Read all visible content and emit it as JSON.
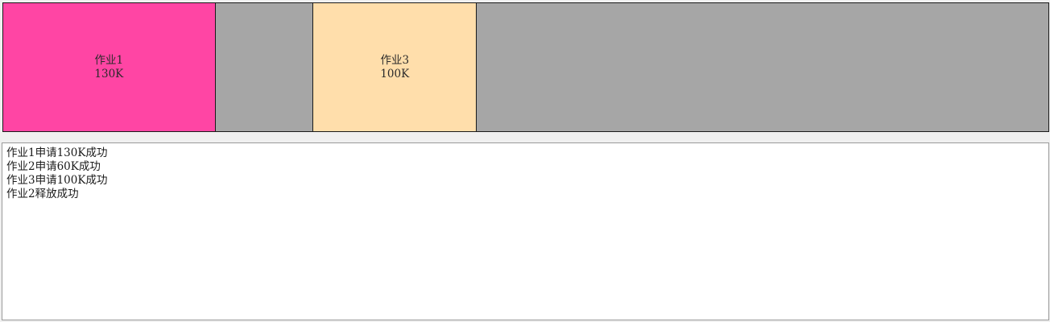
{
  "memory": {
    "blocks": [
      {
        "name": "作业1",
        "size": "130K",
        "color": "#ff45a4",
        "size_kb": 130
      },
      {
        "name": "",
        "size": "",
        "color": "#a6a6a6",
        "size_kb": 60
      },
      {
        "name": "作业3",
        "size": "100K",
        "color": "#ffdeab",
        "size_kb": 100
      },
      {
        "name": "",
        "size": "",
        "color": "#a6a6a6",
        "size_kb": 350
      }
    ]
  },
  "log": {
    "lines": [
      "作业1申请130K成功",
      "作业2申请60K成功",
      "作业3申请100K成功",
      "作业2释放成功"
    ]
  }
}
